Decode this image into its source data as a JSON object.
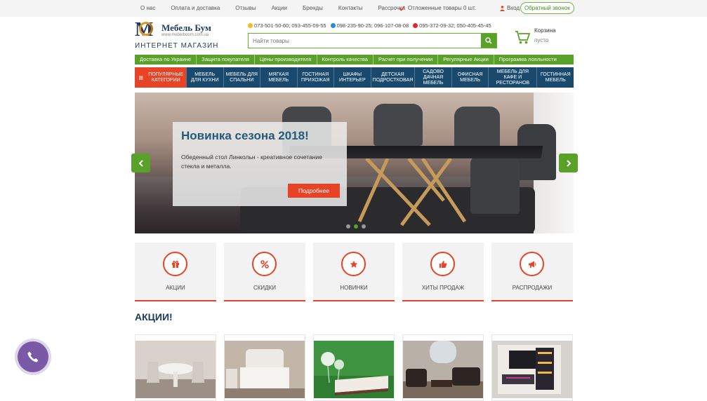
{
  "topbar": {
    "links": [
      "О нас",
      "Оплата и доставка",
      "Отзывы",
      "Акции",
      "Бренды",
      "Контакты",
      "Рассрочка"
    ],
    "deferred": "Отложенные товары 0 шт.",
    "login": "Вход",
    "callback": "Обратный звонок"
  },
  "logo": {
    "letter": "M",
    "brand": "Мебель Бум",
    "site": "www.mebelboom.com.ua",
    "tagline": "ИНТЕРНЕТ МАГАЗИН"
  },
  "phones": [
    "073-501-50-60; 093-455-09-55",
    "098-235-90-25; 096-107-08-08",
    "095-372-09-32; 050-405-45-45"
  ],
  "search": {
    "placeholder": "Найти товары"
  },
  "cart": {
    "title": "Корзина",
    "status": "пусто"
  },
  "greenbar": [
    "Доставка по Украине",
    "Защита покупателя",
    "Цены производителя",
    "Контроль качества",
    "Расчет при получении",
    "Регулярные Акции",
    "Программа лояльности"
  ],
  "categories": {
    "popular": "ПОПУЛЯРНЫЕ КАТЕГОРИИ",
    "items": [
      [
        "МЕБЕЛЬ",
        "ДЛЯ КУХНИ"
      ],
      [
        "МЕБЕЛЬ ДЛЯ",
        "СПАЛЬНИ"
      ],
      [
        "МЯГКАЯ",
        "МЕБЕЛЬ"
      ],
      [
        "ГОСТИНАЯ",
        "ПРИХОЖАЯ"
      ],
      [
        "ШКАФЫ",
        "ИНТЕРЬЕР"
      ],
      [
        "ДЕТСКАЯ",
        "ПОДРОСТКОВАЯ"
      ],
      [
        "САДОВО",
        "ДАЧНАЯ",
        "МЕБЕЛЬ"
      ],
      [
        "ОФИСНАЯ",
        "МЕБЕЛЬ"
      ],
      [
        "МЕБЕЛЬ ДЛЯ КАФЕ И",
        "РЕСТОРАНОВ"
      ],
      [
        "ГОСТИННАЯ",
        "МЕБЕЛЬ"
      ]
    ]
  },
  "slider": {
    "title": "Новинка сезона 2018!",
    "text": "Обеденный стол Линкольн - креативное сочетание стекла и металла.",
    "button": "Подробнее",
    "slides": 3,
    "active": 1
  },
  "features": [
    {
      "label": "АКЦИИ",
      "icon": "gift-icon"
    },
    {
      "label": "СКИДКИ",
      "icon": "percent-icon"
    },
    {
      "label": "НОВИНКИ",
      "icon": "star-icon"
    },
    {
      "label": "ХИТЫ ПРОДАЖ",
      "icon": "thumbs-up-icon"
    },
    {
      "label": "РАСПРОДАЖИ",
      "icon": "megaphone-icon"
    }
  ],
  "sections": {
    "promos": "АКЦИИ!"
  },
  "colors": {
    "green": "#5aa12a",
    "navy": "#194a6e",
    "orange": "#e74427",
    "purple": "#7a5aa6"
  }
}
